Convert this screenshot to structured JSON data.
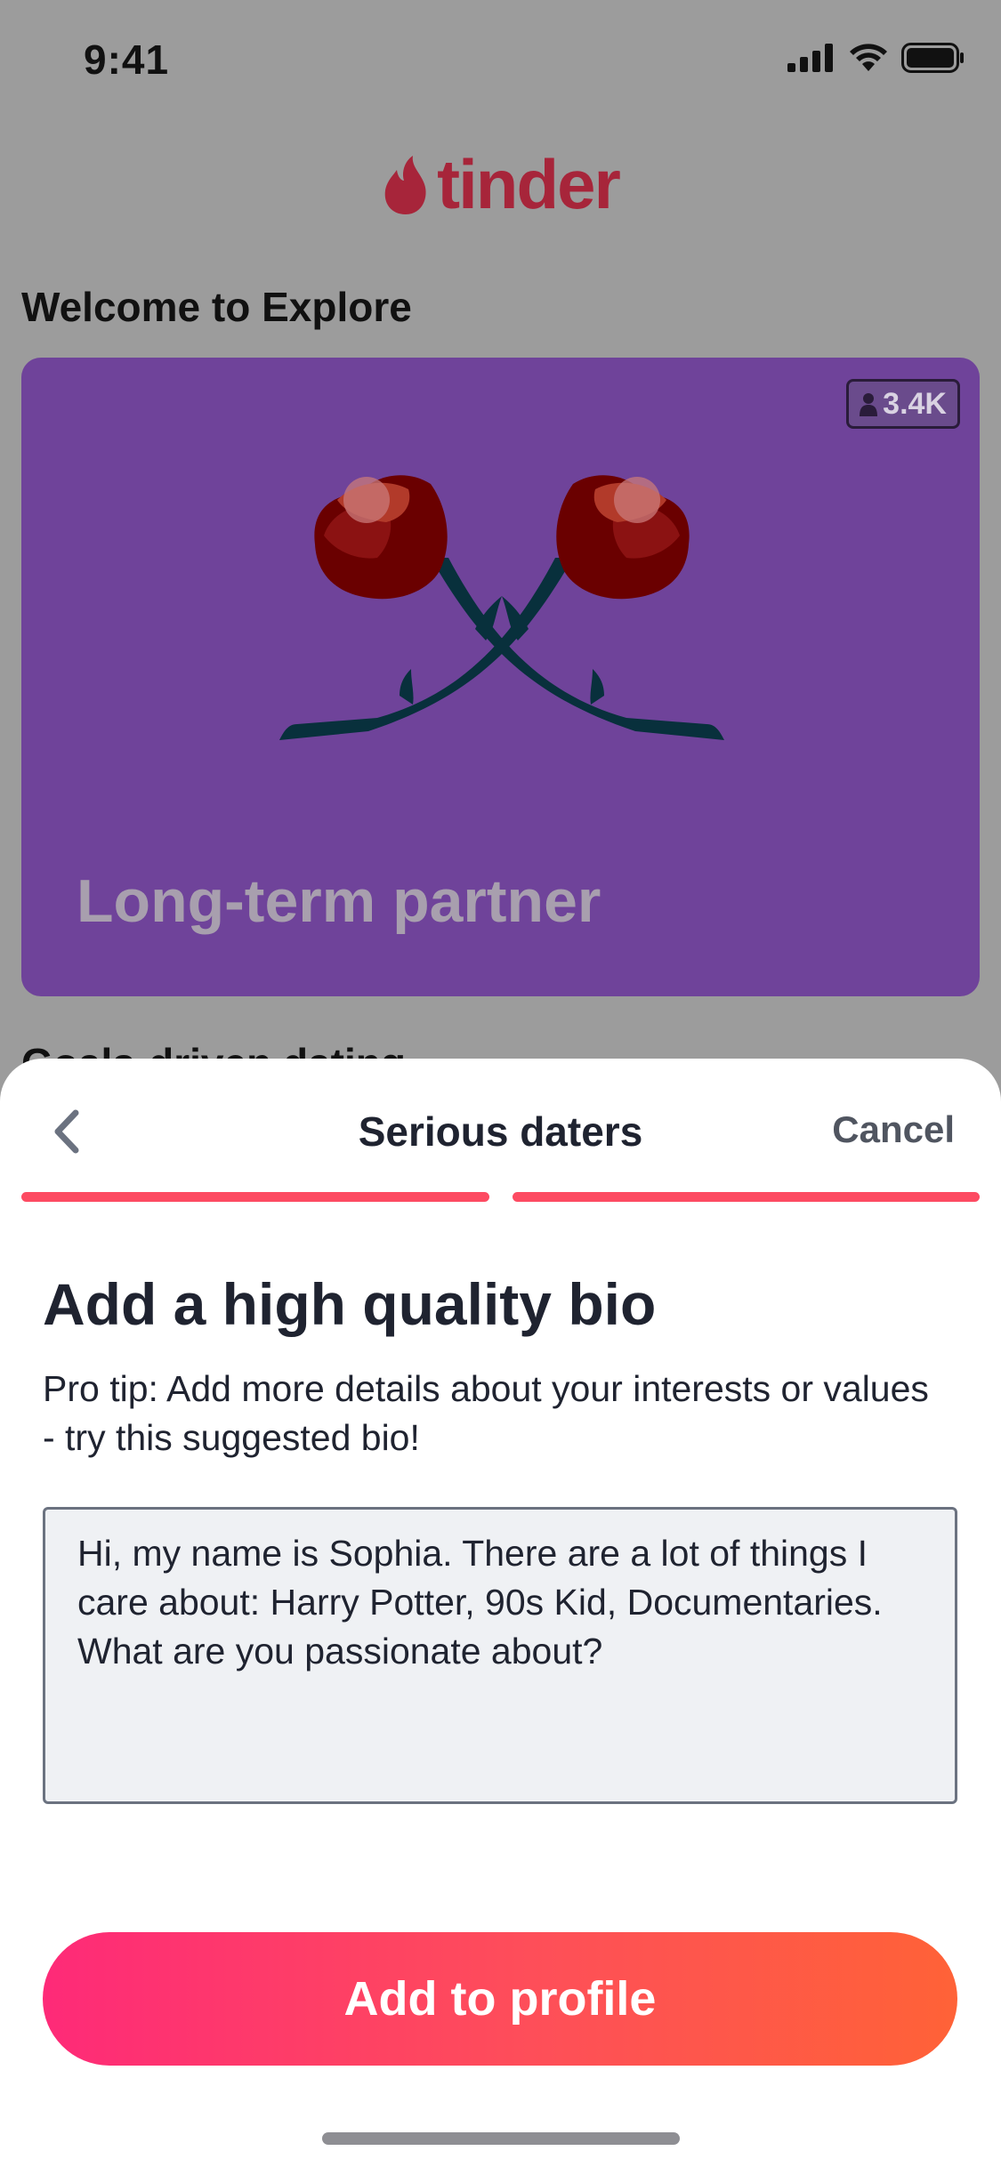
{
  "status_bar": {
    "time": "9:41"
  },
  "app": {
    "logo_text": "tinder"
  },
  "explore": {
    "heading": "Welcome to Explore",
    "card": {
      "title": "Long-term partner",
      "member_count": "3.4K",
      "icon": "roses-illustration"
    },
    "next_section_peek": "Goals-driven dating"
  },
  "sheet": {
    "title": "Serious daters",
    "cancel_label": "Cancel",
    "progress": {
      "steps": 2,
      "current": 2
    },
    "heading": "Add a high quality bio",
    "tip": "Pro tip: Add more details about your interests or values - try this suggested bio!",
    "bio_value": "Hi, my name is Sophia. There are a lot of things I care about: Harry Potter, 90s Kid, Documentaries. What are you passionate about?",
    "button_label": "Add to profile"
  },
  "colors": {
    "brand": "#fd4b62",
    "card_background": "#6f439a",
    "button_gradient_start": "#fe2a78",
    "button_gradient_end": "#ff6237"
  }
}
